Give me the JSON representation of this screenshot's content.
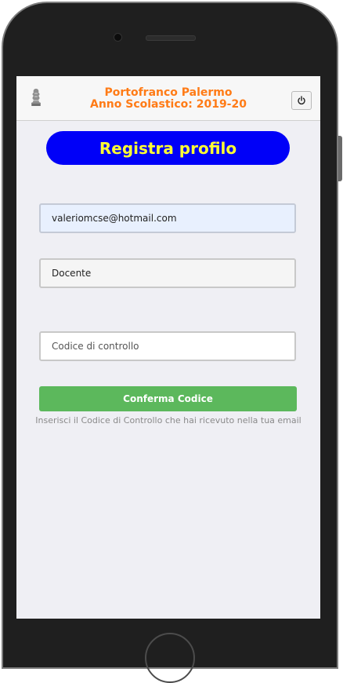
{
  "header": {
    "title_line1": "Portofranco Palermo",
    "title_line2": "Anno Scolastico: 2019-20",
    "title_color": "#ff7b16",
    "logo_icon": "portofranco-logo-icon",
    "power_icon": "power-icon"
  },
  "page_title": "Registra profilo",
  "form": {
    "email_value": "valeriomcse@hotmail.com",
    "role_value": "Docente",
    "code_placeholder": "Codice di controllo",
    "code_value": "",
    "confirm_label": "Conferma Codice",
    "help_text": "Inserisci il Codice di Controllo che hai ricevuto nella tua email"
  },
  "colors": {
    "pill_background": "#0000f8",
    "pill_text": "#ffff33",
    "confirm_button": "#5cb85c",
    "screen_background": "#efeff4"
  }
}
